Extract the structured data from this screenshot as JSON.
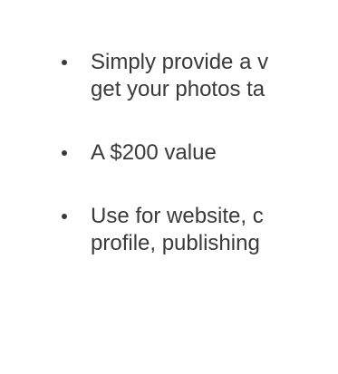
{
  "bullets": [
    {
      "lines": [
        "Simply provide a v",
        "get your photos ta"
      ]
    },
    {
      "lines": [
        "A $200 value"
      ]
    },
    {
      "lines": [
        "Use for website, c",
        "profile, publishing"
      ]
    }
  ]
}
